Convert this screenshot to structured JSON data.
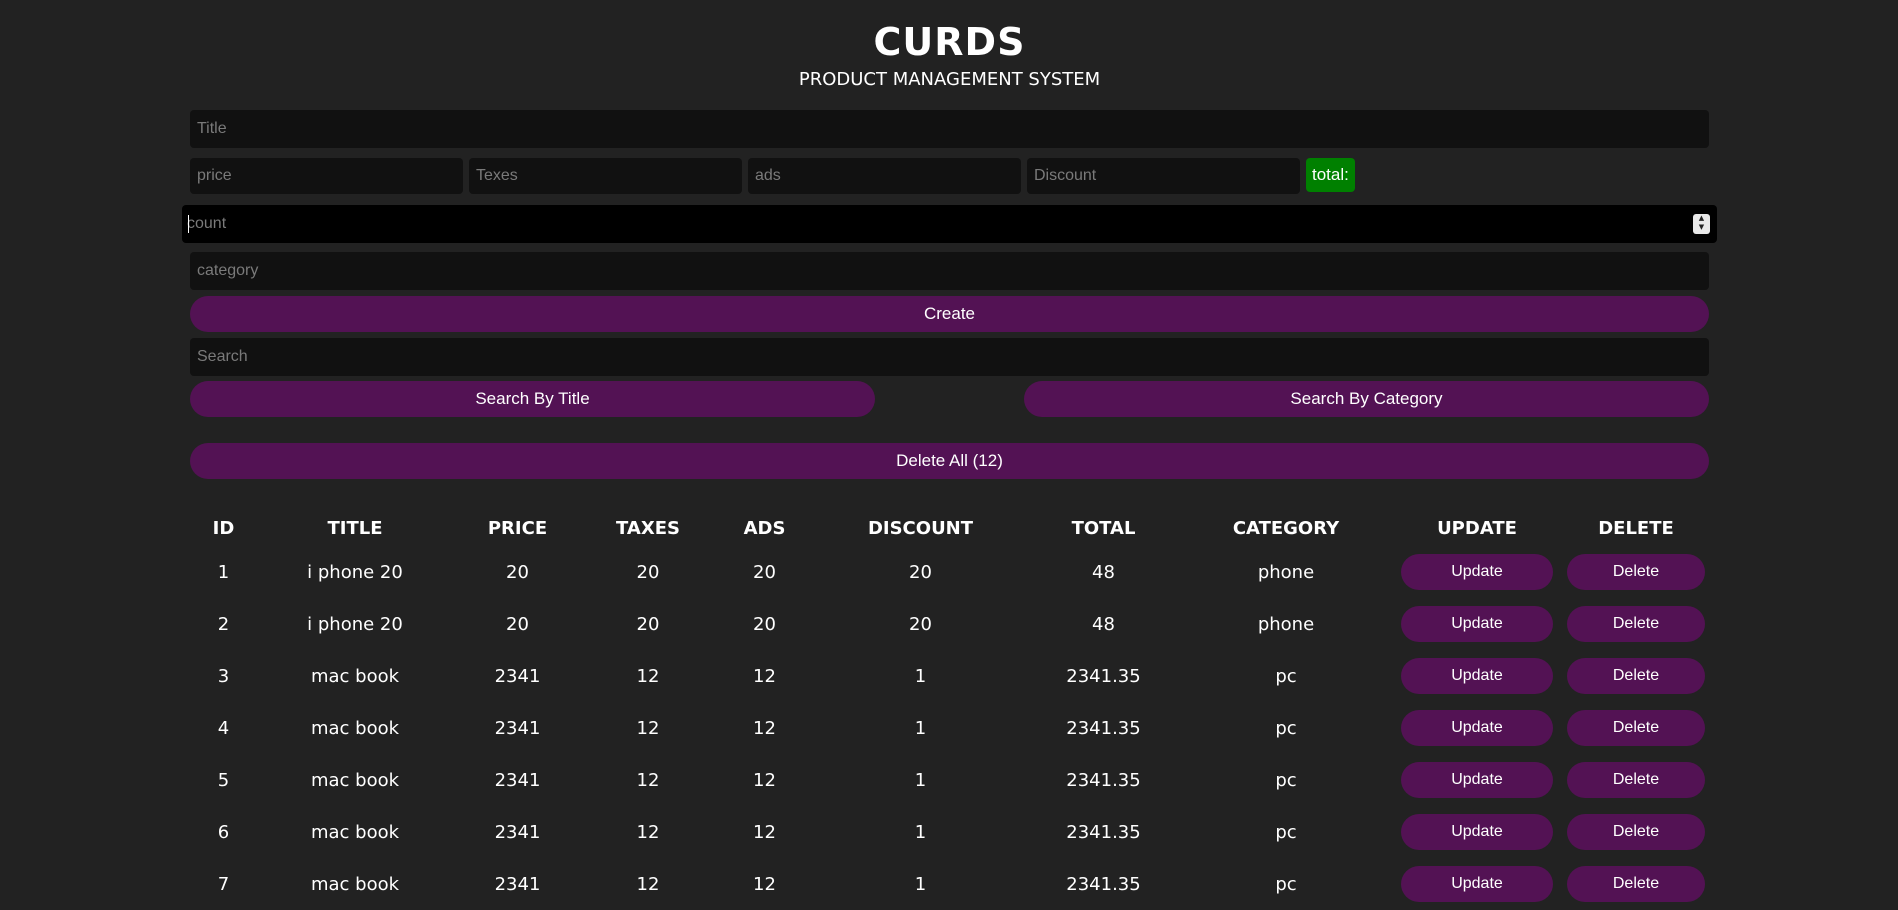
{
  "app": {
    "title": "CURDS",
    "subtitle": "PRODUCT MANAGEMENT SYSTEM"
  },
  "form": {
    "title_placeholder": "Title",
    "price_placeholder": "price",
    "taxes_placeholder": "Texes",
    "ads_placeholder": "ads",
    "discount_placeholder": "Discount",
    "total_label": "total:",
    "total_color": "#008000",
    "count_placeholder": "count",
    "category_placeholder": "category",
    "create_label": "Create",
    "button_color": "#531254"
  },
  "search": {
    "placeholder": "Search",
    "by_title_label": "Search By Title",
    "by_category_label": "Search By Category"
  },
  "delete_all_label": "Delete All (12)",
  "table": {
    "headers": [
      "ID",
      "TITLE",
      "PRICE",
      "TAXES",
      "ADS",
      "DISCOUNT",
      "TOTAL",
      "CATEGORY",
      "UPDATE",
      "DELETE"
    ],
    "update_label": "Update",
    "delete_label": "Delete",
    "rows": [
      {
        "id": "1",
        "title": "i phone 20",
        "price": "20",
        "taxes": "20",
        "ads": "20",
        "discount": "20",
        "total": "48",
        "category": "phone"
      },
      {
        "id": "2",
        "title": "i phone 20",
        "price": "20",
        "taxes": "20",
        "ads": "20",
        "discount": "20",
        "total": "48",
        "category": "phone"
      },
      {
        "id": "3",
        "title": "mac book",
        "price": "2341",
        "taxes": "12",
        "ads": "12",
        "discount": "1",
        "total": "2341.35",
        "category": "pc"
      },
      {
        "id": "4",
        "title": "mac book",
        "price": "2341",
        "taxes": "12",
        "ads": "12",
        "discount": "1",
        "total": "2341.35",
        "category": "pc"
      },
      {
        "id": "5",
        "title": "mac book",
        "price": "2341",
        "taxes": "12",
        "ads": "12",
        "discount": "1",
        "total": "2341.35",
        "category": "pc"
      },
      {
        "id": "6",
        "title": "mac book",
        "price": "2341",
        "taxes": "12",
        "ads": "12",
        "discount": "1",
        "total": "2341.35",
        "category": "pc"
      },
      {
        "id": "7",
        "title": "mac book",
        "price": "2341",
        "taxes": "12",
        "ads": "12",
        "discount": "1",
        "total": "2341.35",
        "category": "pc"
      }
    ]
  }
}
